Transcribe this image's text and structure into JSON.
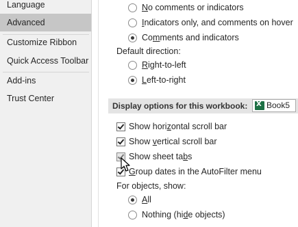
{
  "sidebar": {
    "items": [
      {
        "label": "Language"
      },
      {
        "label": "Advanced"
      },
      {
        "label": "Customize Ribbon"
      },
      {
        "label": "Quick Access Toolbar"
      },
      {
        "label": "Add-ins"
      },
      {
        "label": "Trust Center"
      }
    ]
  },
  "comments": {
    "options": [
      {
        "pre": "",
        "u": "N",
        "post": "o comments or indicators"
      },
      {
        "pre": "",
        "u": "I",
        "post": "ndicators only, and comments on hover"
      },
      {
        "pre": "Co",
        "u": "m",
        "post": "ments and indicators"
      }
    ]
  },
  "direction": {
    "label": "Default direction:",
    "options": [
      {
        "pre": "",
        "u": "R",
        "post": "ight-to-left"
      },
      {
        "pre": "",
        "u": "L",
        "post": "eft-to-right"
      }
    ]
  },
  "workbook_section": {
    "title": "Display options for this workbook:",
    "workbook": "Book5",
    "icon": "excel-icon"
  },
  "workbook_options": [
    {
      "pre": "Show hori",
      "u": "z",
      "post": "ontal scroll bar"
    },
    {
      "pre": "Show ",
      "u": "v",
      "post": "ertical scroll bar"
    },
    {
      "pre": "Show sheet ta",
      "u": "b",
      "post": "s"
    },
    {
      "pre": "",
      "u": "G",
      "post": "roup dates in the AutoFilter menu"
    }
  ],
  "objects": {
    "label": "For objects, show:",
    "options": [
      {
        "pre": "",
        "u": "A",
        "post": "ll"
      },
      {
        "pre": "Nothing (hi",
        "u": "d",
        "post": "e objects)"
      }
    ]
  }
}
